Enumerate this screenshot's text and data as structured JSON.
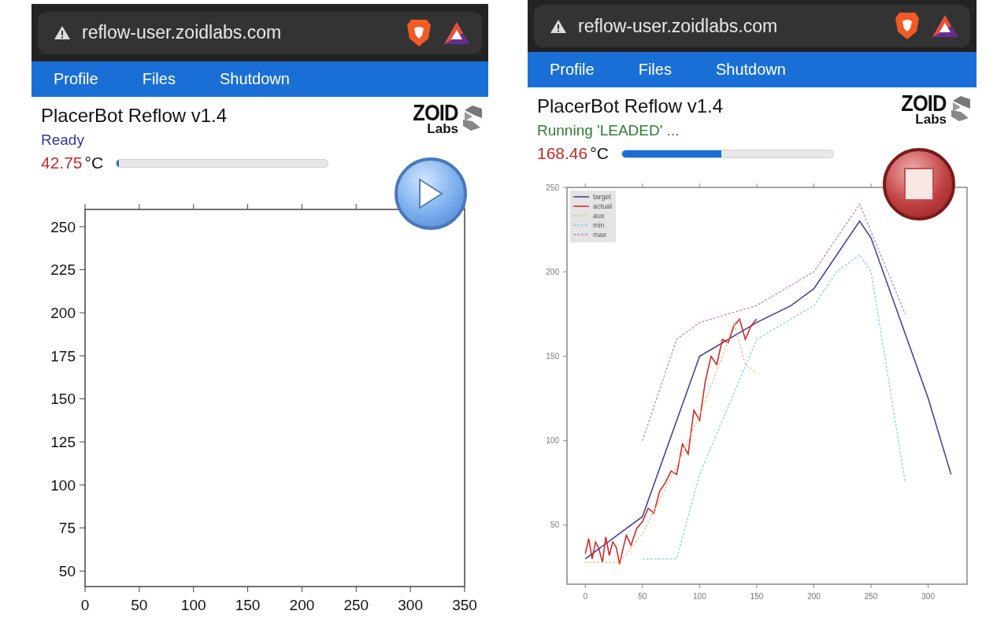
{
  "panels": [
    {
      "address": "reflow-user.zoidlabs.com",
      "nav": [
        "Profile",
        "Files",
        "Shutdown"
      ],
      "title": "PlacerBot Reflow v1.4",
      "logo": {
        "word": "ZOID",
        "sub": "Labs"
      },
      "status": {
        "text": "Ready",
        "kind": "ready"
      },
      "temperature": "42.75",
      "unit": "°C",
      "progress": {
        "level": 0.01
      },
      "control": {
        "kind": "play"
      },
      "chart_data": {
        "type": "line",
        "xlim": [
          0,
          350
        ],
        "ylim": [
          41,
          260
        ],
        "xticks": [
          0,
          50,
          100,
          150,
          200,
          250,
          300,
          350
        ],
        "yticks": [
          50,
          75,
          100,
          125,
          150,
          175,
          200,
          225,
          250
        ]
      }
    },
    {
      "address": "reflow-user.zoidlabs.com",
      "nav": [
        "Profile",
        "Files",
        "Shutdown"
      ],
      "title": "PlacerBot Reflow v1.4",
      "logo": {
        "word": "ZOID",
        "sub": "Labs"
      },
      "status": {
        "text": "Running 'LEADED' ...",
        "kind": "running"
      },
      "temperature": "168.46",
      "unit": "°C",
      "progress": {
        "level": 0.47
      },
      "control": {
        "kind": "stop"
      },
      "chart_data": {
        "type": "line",
        "xlim": [
          -16,
          334
        ],
        "ylim": [
          15,
          250
        ],
        "xticks": [
          0,
          50,
          100,
          150,
          200,
          250,
          300
        ],
        "yticks": [
          50,
          100,
          150,
          200,
          250
        ],
        "legend": true,
        "series": [
          {
            "name": "target",
            "color": "#3a3a9c",
            "x": [
              0,
              50,
              100,
              150,
              180,
              200,
              240,
              250,
              300,
              320
            ],
            "values": [
              30,
              55,
              150,
              170,
              180,
              190,
              230,
              220,
              125,
              80
            ]
          },
          {
            "name": "actual",
            "color": "#d42020",
            "x": [
              0,
              3,
              6,
              9,
              12,
              15,
              18,
              21,
              24,
              27,
              30,
              33,
              36,
              40,
              45,
              50,
              55,
              60,
              65,
              70,
              75,
              80,
              85,
              90,
              95,
              100,
              105,
              110,
              115,
              120,
              125,
              130,
              135,
              140,
              145,
              150
            ],
            "values": [
              33,
              42,
              30,
              40,
              36,
              28,
              43,
              32,
              40,
              37,
              27,
              36,
              44,
              38,
              48,
              52,
              60,
              57,
              70,
              75,
              82,
              80,
              98,
              92,
              118,
              112,
              135,
              150,
              145,
              160,
              158,
              168,
              172,
              160,
              168,
              172
            ]
          },
          {
            "name": "aux",
            "color": "#e0c080",
            "line_style": "dashed",
            "x": [
              0,
              30,
              50,
              80,
              100,
              120,
              130,
              140,
              150
            ],
            "values": [
              28,
              28,
              45,
              85,
              115,
              150,
              170,
              145,
              140
            ]
          },
          {
            "name": "min",
            "color": "#80d0e0",
            "line_style": "dashed",
            "x": [
              50,
              80,
              100,
              150,
              200,
              220,
              240,
              250,
              280
            ],
            "values": [
              30,
              30,
              80,
              160,
              180,
              200,
              210,
              200,
              75
            ]
          },
          {
            "name": "max",
            "color": "#c080b0",
            "line_style": "dashed",
            "x": [
              50,
              80,
              100,
              150,
              200,
              240,
              280
            ],
            "values": [
              100,
              160,
              170,
              180,
              200,
              240,
              175
            ]
          }
        ]
      }
    }
  ]
}
